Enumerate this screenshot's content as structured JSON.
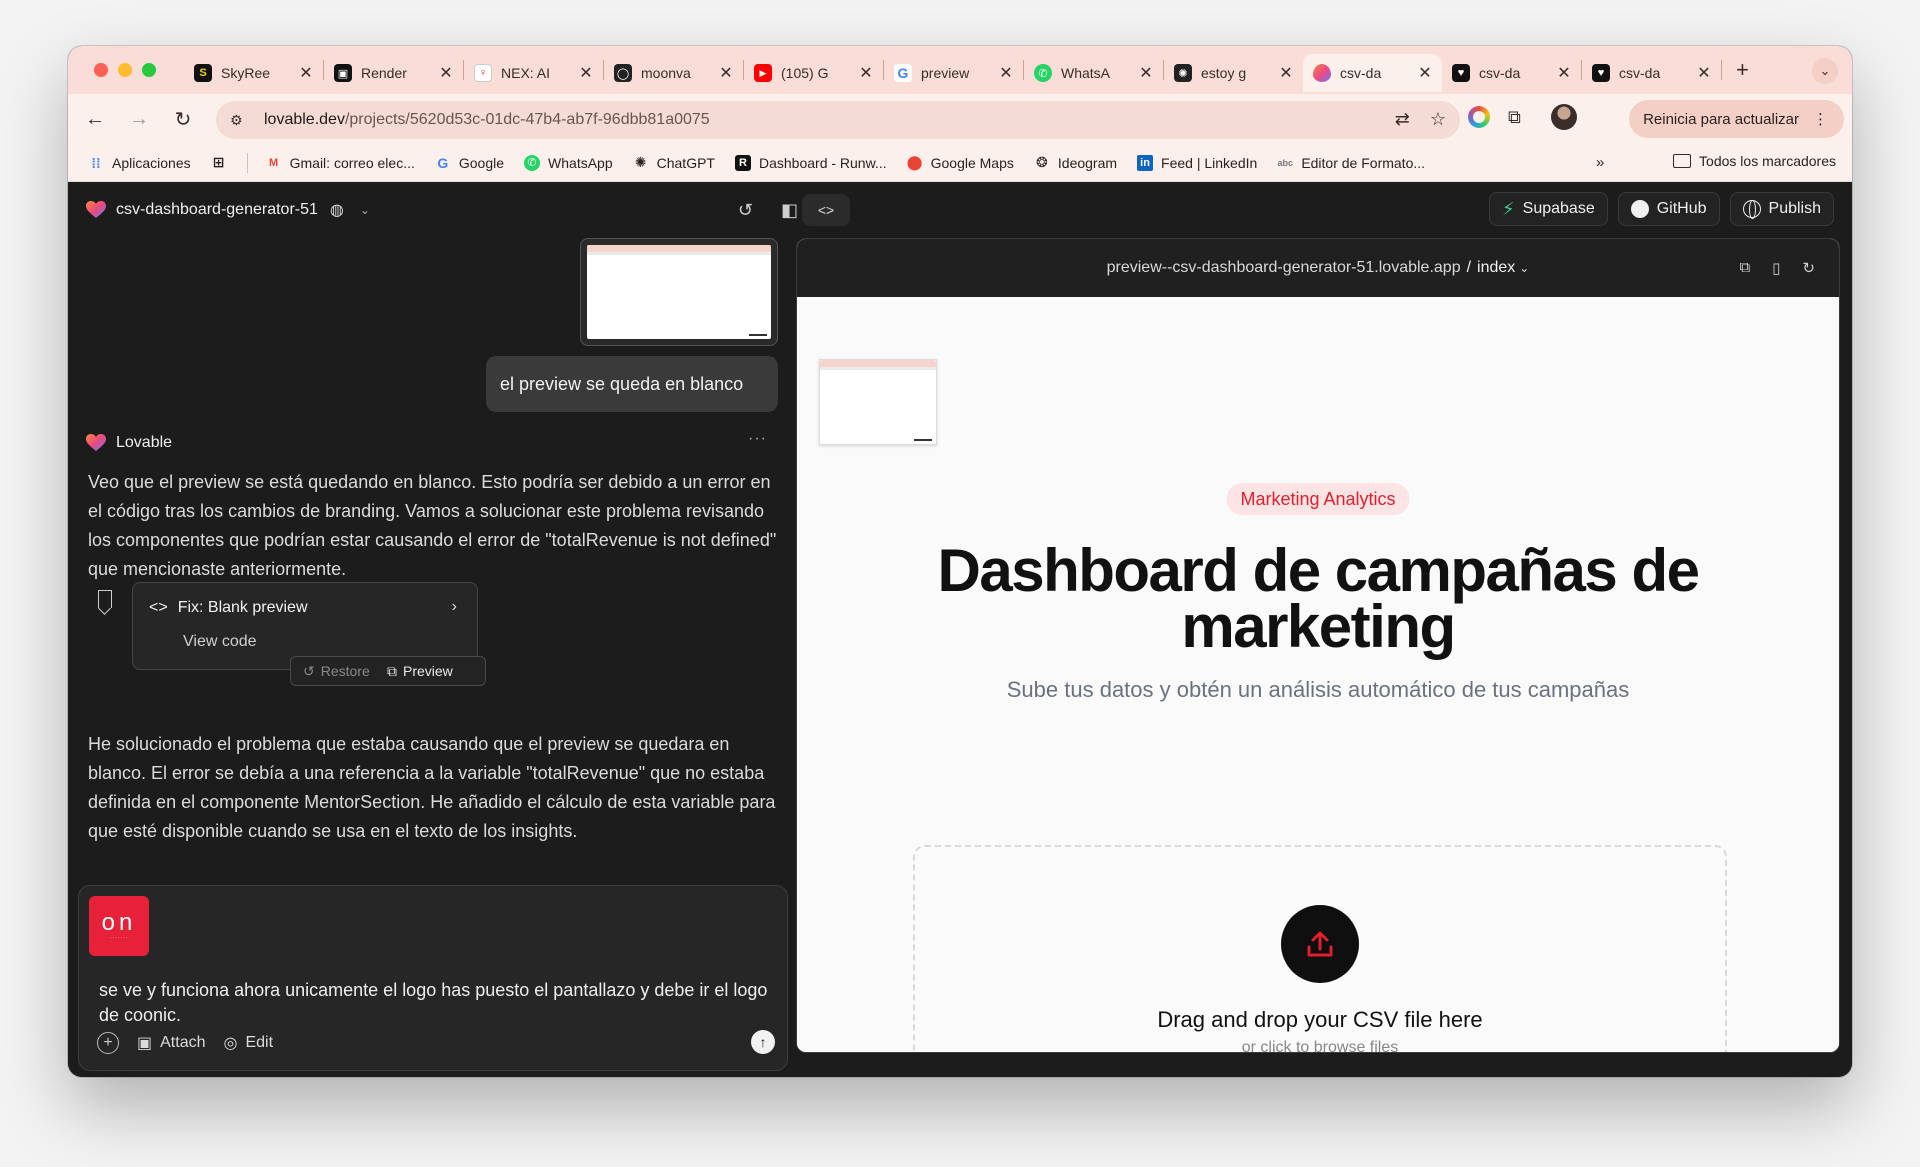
{
  "browser": {
    "tabs": [
      {
        "title": "SkyRee",
        "icon": "skyreels-icon",
        "active": false
      },
      {
        "title": "Render",
        "icon": "render-icon",
        "active": false
      },
      {
        "title": "NEX: AI",
        "icon": "nex-icon",
        "active": false
      },
      {
        "title": "moonva",
        "icon": "moonvalley-icon",
        "active": false
      },
      {
        "title": "(105) G",
        "icon": "youtube-icon",
        "active": false
      },
      {
        "title": "preview",
        "icon": "google-icon",
        "active": false
      },
      {
        "title": "WhatsA",
        "icon": "whatsapp-icon",
        "active": false
      },
      {
        "title": "estoy g",
        "icon": "openai-icon",
        "active": false
      },
      {
        "title": "csv-da",
        "icon": "lovable-heart-icon",
        "active": true
      },
      {
        "title": "csv-da",
        "icon": "lovable-dark-icon",
        "active": false
      },
      {
        "title": "csv-da",
        "icon": "lovable-dark-icon",
        "active": false
      }
    ],
    "new_tab_label": "+",
    "url_host": "lovable.dev",
    "url_path": "/projects/5620d53c-01dc-47b4-ab7f-96dbb81a0075",
    "relaunch_label": "Reinicia para actualizar",
    "bookmarks": [
      {
        "label": "Aplicaciones",
        "icon": "apps-grid-icon"
      },
      {
        "label": "Gmail: correo elec...",
        "icon": "gmail-icon"
      },
      {
        "label": "Google",
        "icon": "google-icon"
      },
      {
        "label": "WhatsApp",
        "icon": "whatsapp-icon"
      },
      {
        "label": "ChatGPT",
        "icon": "openai-icon"
      },
      {
        "label": "Dashboard - Runw...",
        "icon": "runway-icon"
      },
      {
        "label": "Google Maps",
        "icon": "maps-pin-icon"
      },
      {
        "label": "Ideogram",
        "icon": "ideogram-icon"
      },
      {
        "label": "Feed | LinkedIn",
        "icon": "linkedin-icon"
      },
      {
        "label": "Editor de Formato...",
        "icon": "editor-icon"
      }
    ],
    "bookmarks_more": "»",
    "all_bookmarks_label": "Todos los marcadores"
  },
  "app": {
    "project_name": "csv-dashboard-generator-51",
    "supabase_label": "Supabase",
    "github_label": "GitHub",
    "publish_label": "Publish"
  },
  "chat": {
    "user_message": "el preview se queda en blanco",
    "assistant_name": "Lovable",
    "assistant_text_1": "Veo que el preview se está quedando en blanco. Esto podría ser debido a un error en el código tras los cambios de branding. Vamos a solucionar este problema revisando los componentes que podrían estar causando el error de \"totalRevenue is not defined\" que mencionaste anteriormente.",
    "fix_title": "Fix: Blank preview",
    "fix_sub": "View code",
    "restore_label": "Restore",
    "preview_label": "Preview",
    "assistant_text_2": "He solucionado el problema que estaba causando que el preview se quedara en blanco. El error se debía a una referencia a la variable \"totalRevenue\" que no estaba definida en el componente MentorSection. He añadido el cálculo de esta variable para que esté disponible cuando se usa en el texto de los insights."
  },
  "composer": {
    "attachment_text": "on",
    "text": "se ve y funciona ahora unicamente el logo has puesto el pantallazo y debe ir el logo de coonic.",
    "attach_label": "Attach",
    "edit_label": "Edit"
  },
  "preview": {
    "url": "preview--csv-dashboard-generator-51.lovable.app",
    "separator": "/",
    "page": "index",
    "badge": "Marketing Analytics",
    "title_line1": "Dashboard de campañas de",
    "title_line2": "marketing",
    "subtitle": "Sube tus datos y obtén un análisis automático de tus campañas",
    "drop_title": "Drag and drop your CSV file here",
    "drop_sub": "or click to browse files"
  },
  "colors": {
    "tabstrip": "#f9ddd6",
    "app_bg": "#1c1c1c",
    "accent_red": "#e0202e",
    "supabase_green": "#3ecf8e"
  }
}
